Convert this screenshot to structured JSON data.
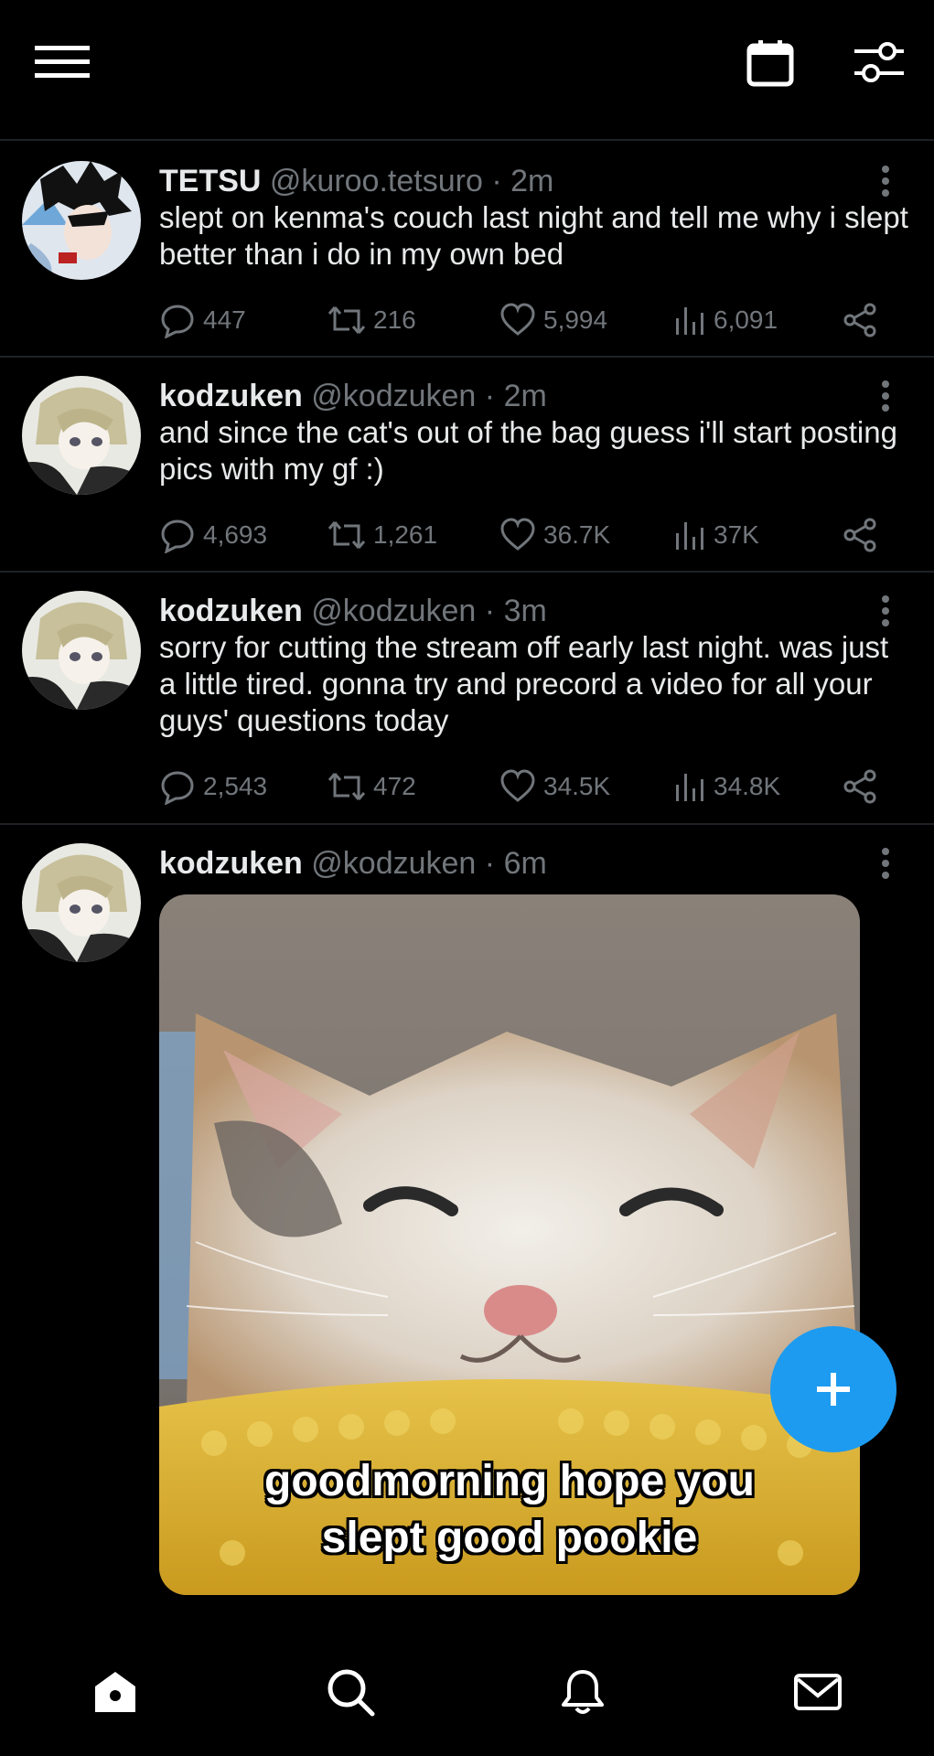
{
  "topbar": {
    "menu_icon": "hamburger-menu-icon",
    "calendar_icon": "calendar-icon",
    "settings_icon": "sliders-icon"
  },
  "tweets": [
    {
      "name": "TETSU",
      "handle": "@kuroo.tetsuro",
      "sep": "·",
      "time": "2m",
      "text": "slept on kenma's couch last night and tell me why i slept better than i do in my own bed",
      "replies": "447",
      "retweets": "216",
      "likes": "5,994",
      "views": "6,091"
    },
    {
      "name": "kodzuken",
      "handle": "@kodzuken",
      "sep": "·",
      "time": "2m",
      "text": "and since the cat's out of the bag guess i'll start posting pics with my gf :)",
      "replies": "4,693",
      "retweets": "1,261",
      "likes": "36.7K",
      "views": "37K"
    },
    {
      "name": "kodzuken",
      "handle": "@kodzuken",
      "sep": "·",
      "time": "3m",
      "text": "sorry for cutting the stream off early last night. was just a little tired. gonna try and precord a video for all your guys' questions today",
      "replies": "2,543",
      "retweets": "472",
      "likes": "34.5K",
      "views": "34.8K"
    },
    {
      "name": "kodzuken",
      "handle": "@kodzuken",
      "sep": "·",
      "time": "6m",
      "media_caption_line1": "goodmorning hope you",
      "media_caption_line2": "slept good pookie"
    }
  ],
  "fab_icon": "plus-icon",
  "bottom_nav": [
    "home-icon",
    "search-icon",
    "bell-icon",
    "mail-icon"
  ],
  "colors": {
    "accent": "#1d9bf0",
    "muted": "#71767b",
    "text": "#e7e9ea",
    "divider": "#1e2226"
  }
}
